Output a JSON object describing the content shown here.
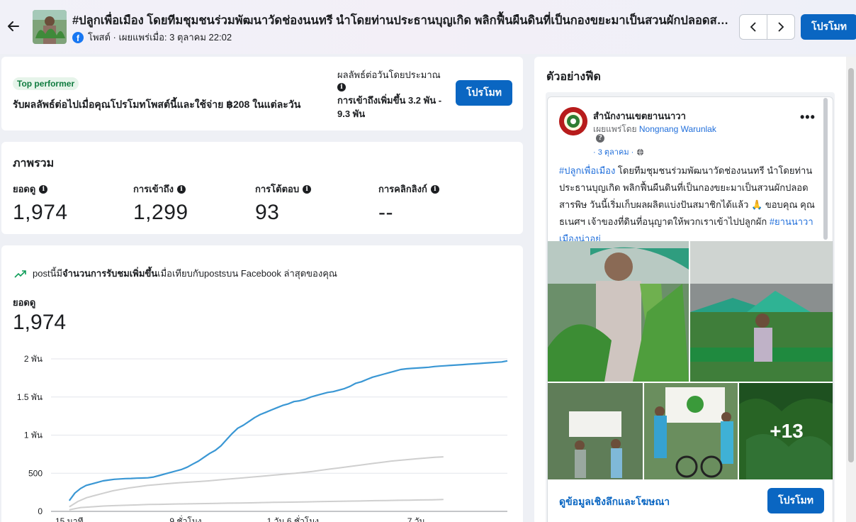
{
  "header": {
    "title": "#ปลูกเพื่อเมือง โดยทีมชุมชนร่วมพัฒนาวัดช่องนนทรี นำโดยท่านประธานบุญเกิด พลิกฟื้นผืนดินที่เป็นกองขยะมาเป็นสวนผักปลอดสารพิษ",
    "meta": "โพสต์ · เผยแพร่เมื่อ: 3 ตุลาคม 22:02",
    "promote_label": "โปรโมท"
  },
  "top_card": {
    "badge": "Top performer",
    "description": "รับผลลัพธ์ต่อไปเมื่อคุณโปรโมทโพสต์นี้และใช้จ่าย ฿208 ในแต่ละวัน",
    "estimate_label": "ผลลัพธ์ต่อวันโดยประมาณ",
    "estimate_value": "การเข้าถึงเพิ่มขึ้น 3.2 พัน - 9.3 พัน",
    "promote_label": "โปรโมท"
  },
  "overview": {
    "title": "ภาพรวม",
    "metrics": [
      {
        "label": "ยอดดู",
        "value": "1,974"
      },
      {
        "label": "การเข้าถึง",
        "value": "1,299"
      },
      {
        "label": "การโต้ตอบ",
        "value": "93"
      },
      {
        "label": "การคลิกลิงก์",
        "value": "--"
      }
    ]
  },
  "chart_card": {
    "trend_prefix": "postนี้มี",
    "trend_bold": "จำนวนการรับชมเพิ่มขึ้น",
    "trend_suffix": "เมื่อเทียบกับpostsบน Facebook ล่าสุดของคุณ",
    "label": "ยอดดู",
    "value": "1,974"
  },
  "chart_data": {
    "type": "line",
    "ylim": [
      0,
      2000
    ],
    "y_ticks": [
      "0",
      "500",
      "1 พัน",
      "1.5 พัน",
      "2 พัน"
    ],
    "x_ticks": [
      "15 นาที",
      "9 ชั่วโมง",
      "1 วัน 6 ชั่วโมง",
      "7 วัน"
    ],
    "series": [
      {
        "color": "#3a97d4",
        "values": [
          140,
          240,
          300,
          340,
          360,
          380,
          400,
          410,
          420,
          425,
          430,
          432,
          435,
          437,
          440,
          450,
          470,
          490,
          510,
          530,
          550,
          580,
          620,
          660,
          710,
          760,
          800,
          860,
          940,
          1020,
          1090,
          1130,
          1180,
          1230,
          1270,
          1300,
          1330,
          1360,
          1390,
          1410,
          1440,
          1450,
          1470,
          1500,
          1520,
          1540,
          1560,
          1570,
          1590,
          1610,
          1640,
          1680,
          1700,
          1730,
          1760,
          1780,
          1800,
          1820,
          1840,
          1860,
          1870,
          1875,
          1880,
          1885,
          1890,
          1900,
          1905,
          1910,
          1915,
          1920,
          1925,
          1930,
          1935,
          1940,
          1945,
          1950,
          1955,
          1960,
          1974
        ]
      },
      {
        "color": "#cfcfcf",
        "values": [
          60,
          130,
          180,
          210,
          240,
          270,
          290,
          310,
          325,
          340,
          350,
          360,
          370,
          378,
          385,
          392,
          400,
          410,
          420,
          430,
          440,
          450,
          460,
          470,
          480,
          490,
          500,
          512,
          525,
          540,
          555,
          570,
          585,
          600,
          615,
          630,
          645,
          660,
          670,
          680,
          690,
          700,
          710,
          715
        ]
      },
      {
        "color": "#cfcfcf",
        "values": [
          20,
          50,
          60,
          70,
          75,
          80,
          85,
          90,
          92,
          95,
          98,
          100,
          102,
          105,
          108,
          110,
          112,
          115,
          118,
          120,
          122,
          125,
          128,
          130,
          132,
          135,
          137,
          140,
          142,
          145,
          147,
          150,
          152,
          155
        ]
      }
    ]
  },
  "preview": {
    "title": "ตัวอย่างฟีด",
    "page_name": "สำนักงานเขตยานนาวา",
    "published_by_label": "เผยแพร่โดย",
    "published_by": "Nongnang Warunlak",
    "date": "· 3 ตุลาคม ·",
    "body_hashtag1": "#ปลูกเพื่อเมือง",
    "body_text": " โดยทีมชุมชนร่วมพัฒนาวัดช่องนนทรี นำโดยท่านประธานบุญเกิด พลิกฟื้นผืนดินที่เป็นกองขยะมาเป็นสวนผักปลอดสารพิษ วันนี้เริ่มเก็บผลผลิตแบ่งปันสมาชิกได้แล้ว 🙏 ขอบคุณ คุณธเนศฯ เจ้าของที่ดินที่อนุญาตให้พวกเราเข้าไปปลูกผัก ",
    "body_hashtag2": "#ยานนาวาเมืองน่าอยู่",
    "more_photos": "+13",
    "insights_link": "ดูข้อมูลเชิงลึกและโฆษณา",
    "promote_label": "โปรโมท"
  }
}
